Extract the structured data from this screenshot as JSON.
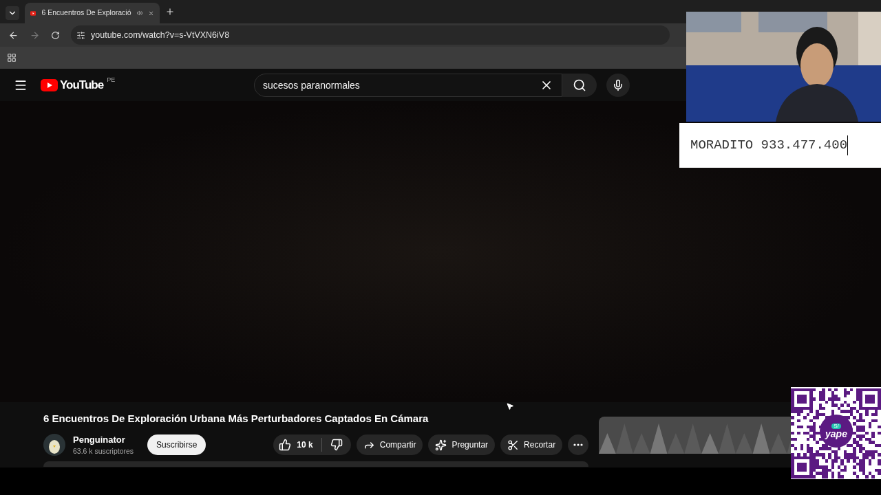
{
  "browser": {
    "tab": {
      "title": "6 Encuentros De Exploració",
      "audio_playing": true
    },
    "address": "youtube.com/watch?v=s-VtVXN6iV8"
  },
  "youtube": {
    "logo": "YouTube",
    "region": "PE",
    "search": {
      "value": "sucesos paranormales"
    }
  },
  "video": {
    "title": "6 Encuentros De Exploración Urbana Más Perturbadores Captados En Cámara",
    "channel": {
      "name": "Penguinator",
      "subscribers": "63.6 k suscriptores"
    },
    "subscribe": "Suscribirse",
    "likes": "10 k",
    "actions": [
      {
        "kind": "share",
        "label": "Compartir"
      },
      {
        "kind": "ask",
        "label": "Preguntar"
      },
      {
        "kind": "clip",
        "label": "Recortar"
      }
    ]
  },
  "overlay": {
    "caption": "MORADITO 933.477.400",
    "qr_logo": "yape",
    "qr_currency": "S/"
  }
}
